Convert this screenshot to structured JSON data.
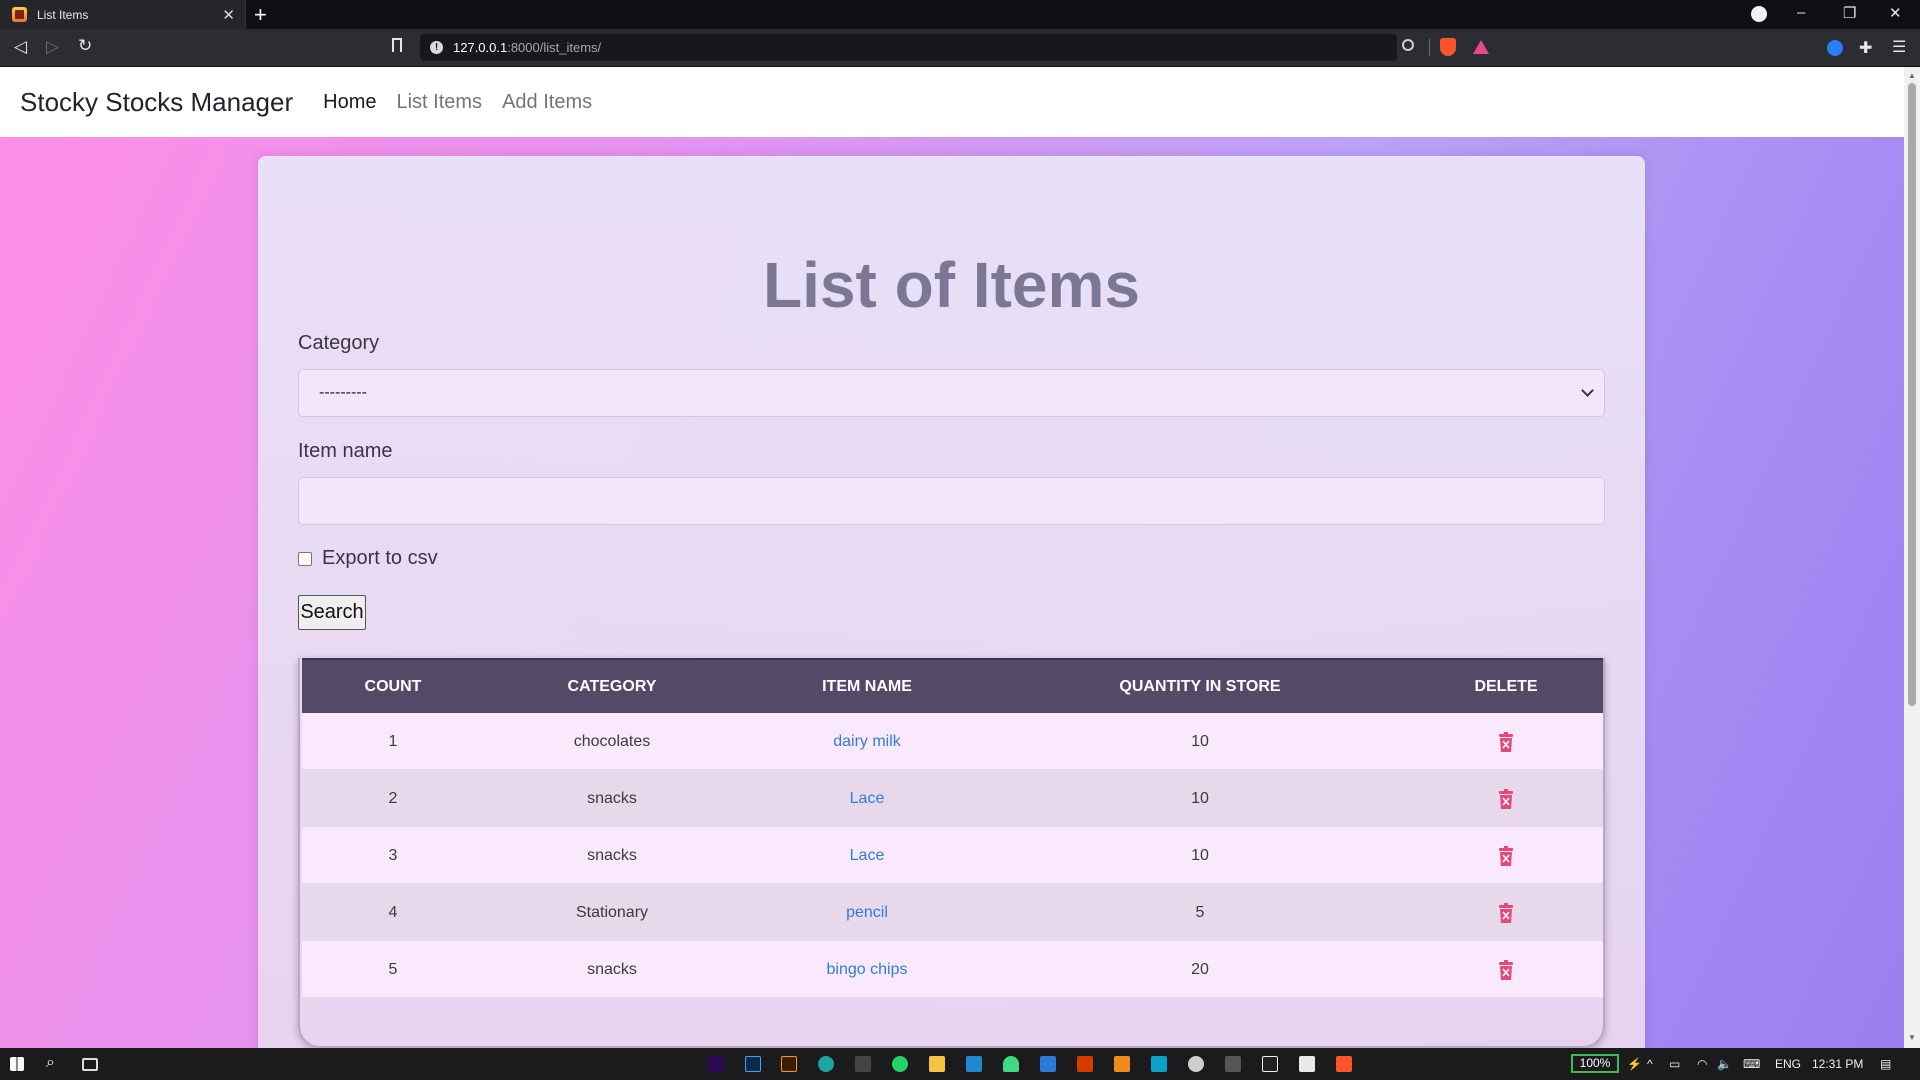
{
  "browser": {
    "tab_title": "List Items",
    "url_host": "127.0.0.1",
    "url_path": ":8000/list_items/"
  },
  "navbar": {
    "brand": "Stocky Stocks Manager",
    "links": [
      "Home",
      "List Items",
      "Add Items"
    ]
  },
  "page": {
    "title": "List of Items",
    "category_label": "Category",
    "category_selected": "---------",
    "item_name_label": "Item name",
    "item_name_value": "",
    "export_label": "Export to csv",
    "export_checked": false,
    "search_button": "Search"
  },
  "table": {
    "headers": [
      "COUNT",
      "CATEGORY",
      "ITEM NAME",
      "QUANTITY IN STORE",
      "DELETE"
    ],
    "rows": [
      {
        "count": "1",
        "category": "chocolates",
        "item_name": "dairy milk",
        "quantity": "10"
      },
      {
        "count": "2",
        "category": "snacks",
        "item_name": "Lace",
        "quantity": "10"
      },
      {
        "count": "3",
        "category": "snacks",
        "item_name": "Lace",
        "quantity": "10"
      },
      {
        "count": "4",
        "category": "Stationary",
        "item_name": "pencil",
        "quantity": "5"
      },
      {
        "count": "5",
        "category": "snacks",
        "item_name": "bingo chips",
        "quantity": "20"
      }
    ]
  },
  "taskbar": {
    "battery": "100%",
    "language": "ENG",
    "time": "12:31 PM"
  },
  "colors": {
    "header_bg": "#544a68",
    "link": "#2f7ed8",
    "delete_icon": "#e8477a"
  }
}
